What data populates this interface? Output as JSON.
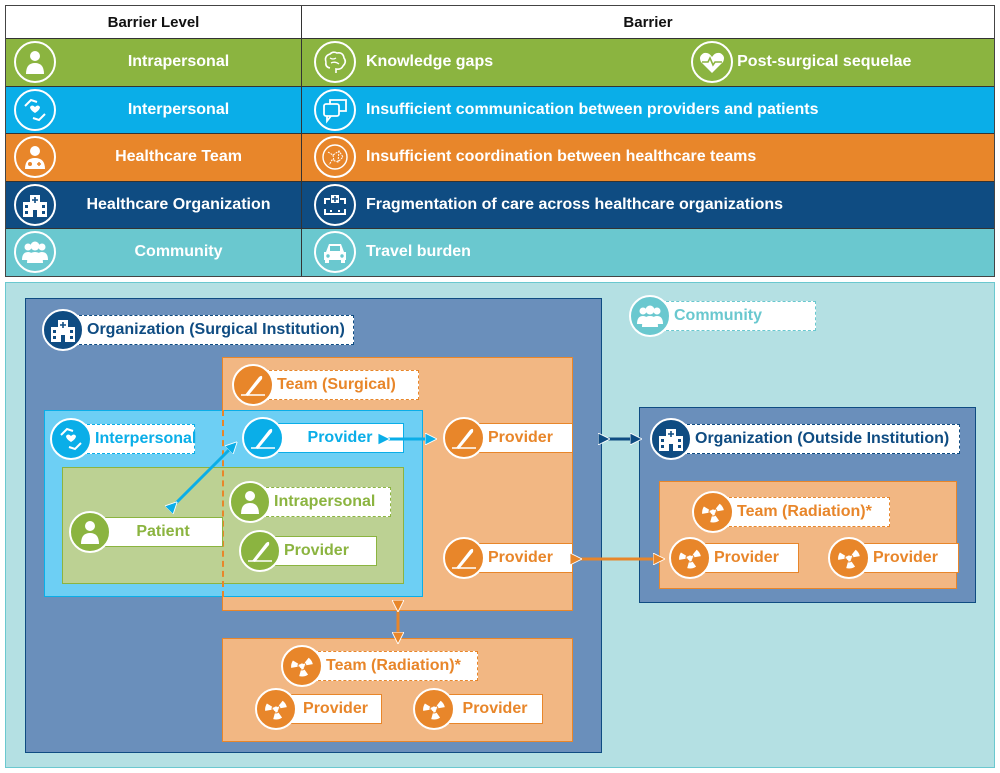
{
  "table": {
    "headers": {
      "level": "Barrier Level",
      "barrier": "Barrier"
    },
    "rows": [
      {
        "level": "Intrapersonal",
        "level_icon": "person-icon",
        "color": "#8bb440",
        "barriers": [
          {
            "text": "Knowledge gaps",
            "icon": "brain-icon"
          },
          {
            "text": "Post-surgical sequelae",
            "icon": "heart-pulse-icon"
          }
        ]
      },
      {
        "level": "Interpersonal",
        "level_icon": "hands-heart-icon",
        "color": "#0aaee8",
        "barriers": [
          {
            "text": "Insufficient communication between providers and patients",
            "icon": "speech-bubbles-icon"
          }
        ]
      },
      {
        "level": "Healthcare Team",
        "level_icon": "doctor-icon",
        "color": "#e8862a",
        "barriers": [
          {
            "text": "Insufficient coordination between healthcare teams",
            "icon": "network-icon"
          }
        ]
      },
      {
        "level": "Healthcare Organization",
        "level_icon": "hospital-icon",
        "color": "#0f4c82",
        "barriers": [
          {
            "text": "Fragmentation of care across healthcare organizations",
            "icon": "fragmented-care-icon"
          }
        ]
      },
      {
        "level": "Community",
        "level_icon": "group-icon",
        "color": "#6ac8cf",
        "barriers": [
          {
            "text": "Travel burden",
            "icon": "car-icon"
          }
        ]
      }
    ]
  },
  "diagram": {
    "community": "Community",
    "org_surgical": "Organization (Surgical Institution)",
    "team_surgical": "Team (Surgical)",
    "interpersonal": "Interpersonal",
    "intrapersonal": "Intrapersonal",
    "patient": "Patient",
    "provider": "Provider",
    "team_radiation": "Team (Radiation)*",
    "org_outside": "Organization (Outside Institution)"
  }
}
